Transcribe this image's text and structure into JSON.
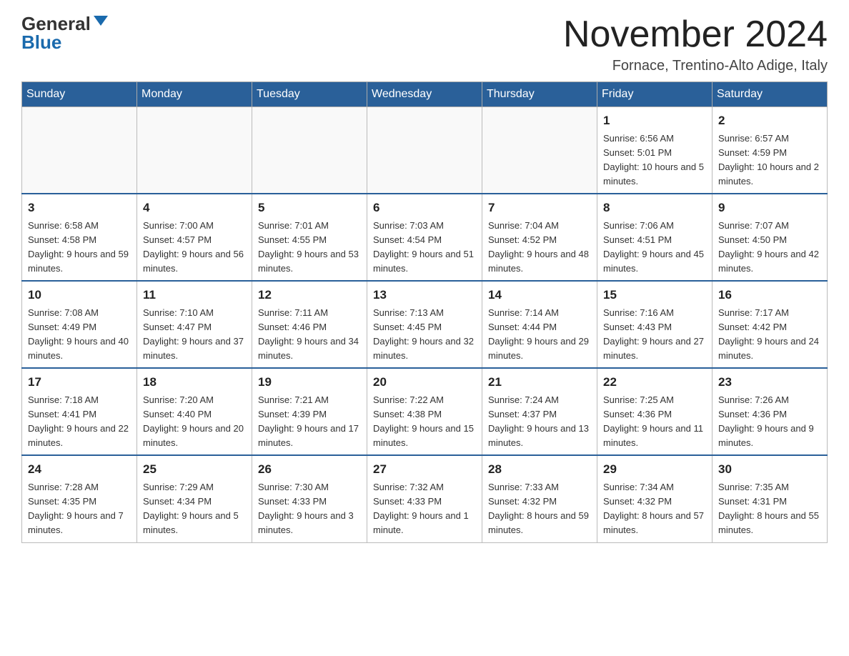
{
  "header": {
    "logo_general": "General",
    "logo_blue": "Blue",
    "month_title": "November 2024",
    "location": "Fornace, Trentino-Alto Adige, Italy"
  },
  "days_of_week": [
    "Sunday",
    "Monday",
    "Tuesday",
    "Wednesday",
    "Thursday",
    "Friday",
    "Saturday"
  ],
  "weeks": [
    {
      "days": [
        {
          "num": "",
          "info": ""
        },
        {
          "num": "",
          "info": ""
        },
        {
          "num": "",
          "info": ""
        },
        {
          "num": "",
          "info": ""
        },
        {
          "num": "",
          "info": ""
        },
        {
          "num": "1",
          "info": "Sunrise: 6:56 AM\nSunset: 5:01 PM\nDaylight: 10 hours and 5 minutes."
        },
        {
          "num": "2",
          "info": "Sunrise: 6:57 AM\nSunset: 4:59 PM\nDaylight: 10 hours and 2 minutes."
        }
      ]
    },
    {
      "days": [
        {
          "num": "3",
          "info": "Sunrise: 6:58 AM\nSunset: 4:58 PM\nDaylight: 9 hours and 59 minutes."
        },
        {
          "num": "4",
          "info": "Sunrise: 7:00 AM\nSunset: 4:57 PM\nDaylight: 9 hours and 56 minutes."
        },
        {
          "num": "5",
          "info": "Sunrise: 7:01 AM\nSunset: 4:55 PM\nDaylight: 9 hours and 53 minutes."
        },
        {
          "num": "6",
          "info": "Sunrise: 7:03 AM\nSunset: 4:54 PM\nDaylight: 9 hours and 51 minutes."
        },
        {
          "num": "7",
          "info": "Sunrise: 7:04 AM\nSunset: 4:52 PM\nDaylight: 9 hours and 48 minutes."
        },
        {
          "num": "8",
          "info": "Sunrise: 7:06 AM\nSunset: 4:51 PM\nDaylight: 9 hours and 45 minutes."
        },
        {
          "num": "9",
          "info": "Sunrise: 7:07 AM\nSunset: 4:50 PM\nDaylight: 9 hours and 42 minutes."
        }
      ]
    },
    {
      "days": [
        {
          "num": "10",
          "info": "Sunrise: 7:08 AM\nSunset: 4:49 PM\nDaylight: 9 hours and 40 minutes."
        },
        {
          "num": "11",
          "info": "Sunrise: 7:10 AM\nSunset: 4:47 PM\nDaylight: 9 hours and 37 minutes."
        },
        {
          "num": "12",
          "info": "Sunrise: 7:11 AM\nSunset: 4:46 PM\nDaylight: 9 hours and 34 minutes."
        },
        {
          "num": "13",
          "info": "Sunrise: 7:13 AM\nSunset: 4:45 PM\nDaylight: 9 hours and 32 minutes."
        },
        {
          "num": "14",
          "info": "Sunrise: 7:14 AM\nSunset: 4:44 PM\nDaylight: 9 hours and 29 minutes."
        },
        {
          "num": "15",
          "info": "Sunrise: 7:16 AM\nSunset: 4:43 PM\nDaylight: 9 hours and 27 minutes."
        },
        {
          "num": "16",
          "info": "Sunrise: 7:17 AM\nSunset: 4:42 PM\nDaylight: 9 hours and 24 minutes."
        }
      ]
    },
    {
      "days": [
        {
          "num": "17",
          "info": "Sunrise: 7:18 AM\nSunset: 4:41 PM\nDaylight: 9 hours and 22 minutes."
        },
        {
          "num": "18",
          "info": "Sunrise: 7:20 AM\nSunset: 4:40 PM\nDaylight: 9 hours and 20 minutes."
        },
        {
          "num": "19",
          "info": "Sunrise: 7:21 AM\nSunset: 4:39 PM\nDaylight: 9 hours and 17 minutes."
        },
        {
          "num": "20",
          "info": "Sunrise: 7:22 AM\nSunset: 4:38 PM\nDaylight: 9 hours and 15 minutes."
        },
        {
          "num": "21",
          "info": "Sunrise: 7:24 AM\nSunset: 4:37 PM\nDaylight: 9 hours and 13 minutes."
        },
        {
          "num": "22",
          "info": "Sunrise: 7:25 AM\nSunset: 4:36 PM\nDaylight: 9 hours and 11 minutes."
        },
        {
          "num": "23",
          "info": "Sunrise: 7:26 AM\nSunset: 4:36 PM\nDaylight: 9 hours and 9 minutes."
        }
      ]
    },
    {
      "days": [
        {
          "num": "24",
          "info": "Sunrise: 7:28 AM\nSunset: 4:35 PM\nDaylight: 9 hours and 7 minutes."
        },
        {
          "num": "25",
          "info": "Sunrise: 7:29 AM\nSunset: 4:34 PM\nDaylight: 9 hours and 5 minutes."
        },
        {
          "num": "26",
          "info": "Sunrise: 7:30 AM\nSunset: 4:33 PM\nDaylight: 9 hours and 3 minutes."
        },
        {
          "num": "27",
          "info": "Sunrise: 7:32 AM\nSunset: 4:33 PM\nDaylight: 9 hours and 1 minute."
        },
        {
          "num": "28",
          "info": "Sunrise: 7:33 AM\nSunset: 4:32 PM\nDaylight: 8 hours and 59 minutes."
        },
        {
          "num": "29",
          "info": "Sunrise: 7:34 AM\nSunset: 4:32 PM\nDaylight: 8 hours and 57 minutes."
        },
        {
          "num": "30",
          "info": "Sunrise: 7:35 AM\nSunset: 4:31 PM\nDaylight: 8 hours and 55 minutes."
        }
      ]
    }
  ]
}
